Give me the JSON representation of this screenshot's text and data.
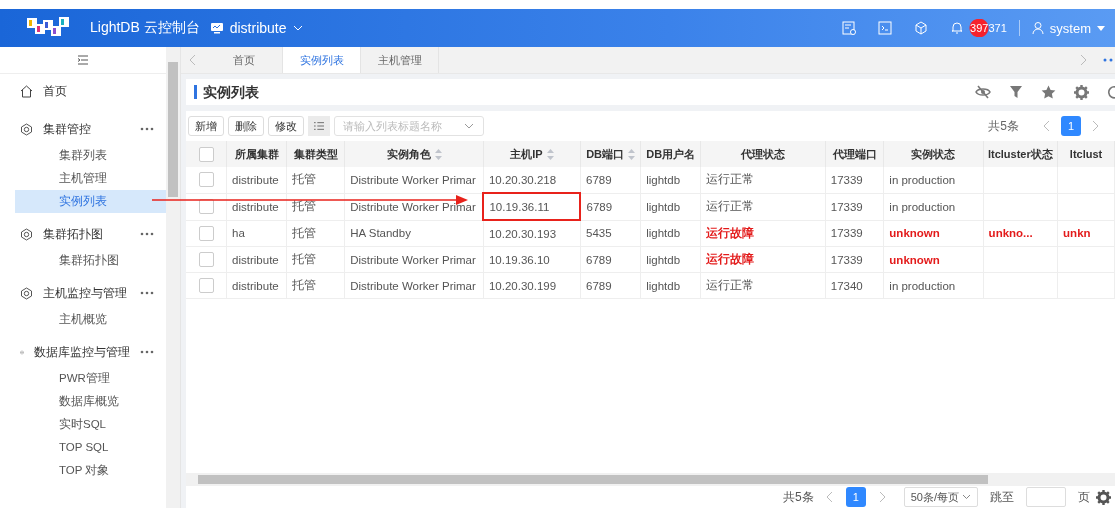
{
  "header": {
    "product": "LightDB 云控制台",
    "workspace": "distribute",
    "notifications": "397371",
    "user": "system"
  },
  "sidebar": {
    "items": [
      {
        "label": "首页",
        "kind": "home"
      },
      {
        "label": "集群管控",
        "kind": "group",
        "children": [
          {
            "label": "集群列表",
            "selected": false
          },
          {
            "label": "主机管理",
            "selected": false
          },
          {
            "label": "实例列表",
            "selected": true
          }
        ]
      },
      {
        "label": "集群拓扑图",
        "kind": "group",
        "children": [
          {
            "label": "集群拓扑图",
            "selected": false
          }
        ]
      },
      {
        "label": "主机监控与管理",
        "kind": "group",
        "children": [
          {
            "label": "主机概览",
            "selected": false
          }
        ]
      },
      {
        "label": "数据库监控与管理",
        "kind": "group",
        "children": [
          {
            "label": "PWR管理",
            "selected": false
          },
          {
            "label": "数据库概览",
            "selected": false
          },
          {
            "label": "实时SQL",
            "selected": false
          },
          {
            "label": "TOP SQL",
            "selected": false
          },
          {
            "label": "TOP 对象",
            "selected": false
          }
        ]
      }
    ]
  },
  "tabs": [
    {
      "label": "首页",
      "selected": false
    },
    {
      "label": "实例列表",
      "selected": true
    },
    {
      "label": "主机管理",
      "selected": false
    }
  ],
  "page": {
    "title": "实例列表"
  },
  "toolbar": {
    "buttons": [
      "新增",
      "删除",
      "修改"
    ],
    "search": {
      "placeholder": "请输入列表标题名称"
    },
    "total": "共5条",
    "page": "1"
  },
  "table": {
    "all_checked": false,
    "columns": [
      {
        "label": "所属集群"
      },
      {
        "label": "集群类型"
      },
      {
        "label": "实例角色",
        "sortable": true
      },
      {
        "label": "主机IP",
        "sortable": true
      },
      {
        "label": "DB端口",
        "sortable": true
      },
      {
        "label": "DB用户名"
      },
      {
        "label": "代理状态"
      },
      {
        "label": "代理端口"
      },
      {
        "label": "实例状态"
      },
      {
        "label": "ltcluster状态"
      },
      {
        "label": "ltclust"
      }
    ],
    "rows": [
      {
        "checked": false,
        "cells": [
          {
            "text": "distribute"
          },
          {
            "text": "托管"
          },
          {
            "text": "Distribute Worker Primar"
          },
          {
            "text": "10.20.30.218"
          },
          {
            "text": "6789"
          },
          {
            "text": "lightdb"
          },
          {
            "text": "运行正常"
          },
          {
            "text": "17339"
          },
          {
            "text": "in production"
          },
          null,
          null
        ]
      },
      {
        "checked": false,
        "highlighted": true,
        "cells": [
          {
            "text": "distribute"
          },
          {
            "text": "托管"
          },
          {
            "text": "Distribute Worker Primar"
          },
          {
            "text": "10.19.36.11"
          },
          {
            "text": "6789"
          },
          {
            "text": "lightdb"
          },
          {
            "text": "运行正常"
          },
          {
            "text": "17339"
          },
          {
            "text": "in production"
          },
          null,
          null
        ]
      },
      {
        "checked": false,
        "cells": [
          {
            "text": "ha"
          },
          {
            "text": "托管"
          },
          {
            "text": "HA Standby"
          },
          {
            "text": "10.20.30.193"
          },
          {
            "text": "5435"
          },
          {
            "text": "lightdb"
          },
          {
            "text": "运行故障",
            "alert": true
          },
          {
            "text": "17339"
          },
          {
            "text": "unknown",
            "alert": true
          },
          {
            "text": "unkno...",
            "alert": true
          },
          {
            "text": "unkn",
            "alert": true
          }
        ]
      },
      {
        "checked": false,
        "cells": [
          {
            "text": "distribute"
          },
          {
            "text": "托管"
          },
          {
            "text": "Distribute Worker Primar"
          },
          {
            "text": "10.19.36.10"
          },
          {
            "text": "6789"
          },
          {
            "text": "lightdb"
          },
          {
            "text": "运行故障",
            "alert": true
          },
          {
            "text": "17339"
          },
          {
            "text": "unknown",
            "alert": true
          },
          null,
          null
        ]
      },
      {
        "checked": false,
        "cells": [
          {
            "text": "distribute"
          },
          {
            "text": "托管"
          },
          {
            "text": "Distribute Worker Primar"
          },
          {
            "text": "10.20.30.199"
          },
          {
            "text": "6789"
          },
          {
            "text": "lightdb"
          },
          {
            "text": "运行正常"
          },
          {
            "text": "17340"
          },
          {
            "text": "in production"
          },
          null,
          null
        ]
      }
    ]
  },
  "pagination": {
    "total": "共5条",
    "page": "1",
    "page_size": "50条/每页",
    "jump_label": "跳至",
    "page_unit": "页"
  }
}
